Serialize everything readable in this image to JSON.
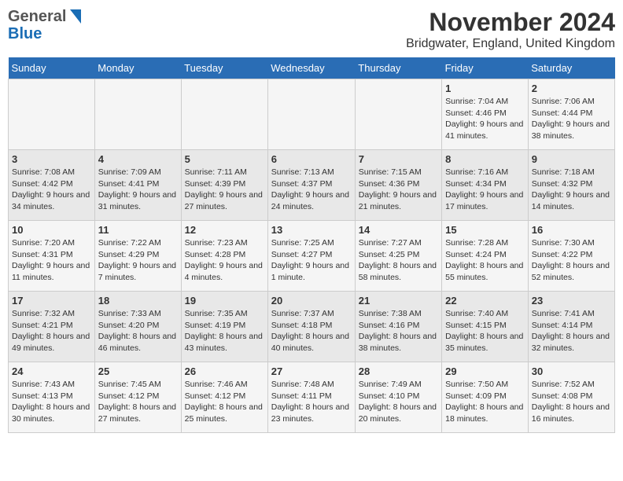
{
  "header": {
    "title": "November 2024",
    "subtitle": "Bridgwater, England, United Kingdom",
    "logo_gen": "General",
    "logo_blue": "Blue"
  },
  "weekdays": [
    "Sunday",
    "Monday",
    "Tuesday",
    "Wednesday",
    "Thursday",
    "Friday",
    "Saturday"
  ],
  "weeks": [
    [
      {
        "day": "",
        "info": ""
      },
      {
        "day": "",
        "info": ""
      },
      {
        "day": "",
        "info": ""
      },
      {
        "day": "",
        "info": ""
      },
      {
        "day": "",
        "info": ""
      },
      {
        "day": "1",
        "info": "Sunrise: 7:04 AM\nSunset: 4:46 PM\nDaylight: 9 hours and 41 minutes."
      },
      {
        "day": "2",
        "info": "Sunrise: 7:06 AM\nSunset: 4:44 PM\nDaylight: 9 hours and 38 minutes."
      }
    ],
    [
      {
        "day": "3",
        "info": "Sunrise: 7:08 AM\nSunset: 4:42 PM\nDaylight: 9 hours and 34 minutes."
      },
      {
        "day": "4",
        "info": "Sunrise: 7:09 AM\nSunset: 4:41 PM\nDaylight: 9 hours and 31 minutes."
      },
      {
        "day": "5",
        "info": "Sunrise: 7:11 AM\nSunset: 4:39 PM\nDaylight: 9 hours and 27 minutes."
      },
      {
        "day": "6",
        "info": "Sunrise: 7:13 AM\nSunset: 4:37 PM\nDaylight: 9 hours and 24 minutes."
      },
      {
        "day": "7",
        "info": "Sunrise: 7:15 AM\nSunset: 4:36 PM\nDaylight: 9 hours and 21 minutes."
      },
      {
        "day": "8",
        "info": "Sunrise: 7:16 AM\nSunset: 4:34 PM\nDaylight: 9 hours and 17 minutes."
      },
      {
        "day": "9",
        "info": "Sunrise: 7:18 AM\nSunset: 4:32 PM\nDaylight: 9 hours and 14 minutes."
      }
    ],
    [
      {
        "day": "10",
        "info": "Sunrise: 7:20 AM\nSunset: 4:31 PM\nDaylight: 9 hours and 11 minutes."
      },
      {
        "day": "11",
        "info": "Sunrise: 7:22 AM\nSunset: 4:29 PM\nDaylight: 9 hours and 7 minutes."
      },
      {
        "day": "12",
        "info": "Sunrise: 7:23 AM\nSunset: 4:28 PM\nDaylight: 9 hours and 4 minutes."
      },
      {
        "day": "13",
        "info": "Sunrise: 7:25 AM\nSunset: 4:27 PM\nDaylight: 9 hours and 1 minute."
      },
      {
        "day": "14",
        "info": "Sunrise: 7:27 AM\nSunset: 4:25 PM\nDaylight: 8 hours and 58 minutes."
      },
      {
        "day": "15",
        "info": "Sunrise: 7:28 AM\nSunset: 4:24 PM\nDaylight: 8 hours and 55 minutes."
      },
      {
        "day": "16",
        "info": "Sunrise: 7:30 AM\nSunset: 4:22 PM\nDaylight: 8 hours and 52 minutes."
      }
    ],
    [
      {
        "day": "17",
        "info": "Sunrise: 7:32 AM\nSunset: 4:21 PM\nDaylight: 8 hours and 49 minutes."
      },
      {
        "day": "18",
        "info": "Sunrise: 7:33 AM\nSunset: 4:20 PM\nDaylight: 8 hours and 46 minutes."
      },
      {
        "day": "19",
        "info": "Sunrise: 7:35 AM\nSunset: 4:19 PM\nDaylight: 8 hours and 43 minutes."
      },
      {
        "day": "20",
        "info": "Sunrise: 7:37 AM\nSunset: 4:18 PM\nDaylight: 8 hours and 40 minutes."
      },
      {
        "day": "21",
        "info": "Sunrise: 7:38 AM\nSunset: 4:16 PM\nDaylight: 8 hours and 38 minutes."
      },
      {
        "day": "22",
        "info": "Sunrise: 7:40 AM\nSunset: 4:15 PM\nDaylight: 8 hours and 35 minutes."
      },
      {
        "day": "23",
        "info": "Sunrise: 7:41 AM\nSunset: 4:14 PM\nDaylight: 8 hours and 32 minutes."
      }
    ],
    [
      {
        "day": "24",
        "info": "Sunrise: 7:43 AM\nSunset: 4:13 PM\nDaylight: 8 hours and 30 minutes."
      },
      {
        "day": "25",
        "info": "Sunrise: 7:45 AM\nSunset: 4:12 PM\nDaylight: 8 hours and 27 minutes."
      },
      {
        "day": "26",
        "info": "Sunrise: 7:46 AM\nSunset: 4:12 PM\nDaylight: 8 hours and 25 minutes."
      },
      {
        "day": "27",
        "info": "Sunrise: 7:48 AM\nSunset: 4:11 PM\nDaylight: 8 hours and 23 minutes."
      },
      {
        "day": "28",
        "info": "Sunrise: 7:49 AM\nSunset: 4:10 PM\nDaylight: 8 hours and 20 minutes."
      },
      {
        "day": "29",
        "info": "Sunrise: 7:50 AM\nSunset: 4:09 PM\nDaylight: 8 hours and 18 minutes."
      },
      {
        "day": "30",
        "info": "Sunrise: 7:52 AM\nSunset: 4:08 PM\nDaylight: 8 hours and 16 minutes."
      }
    ]
  ]
}
